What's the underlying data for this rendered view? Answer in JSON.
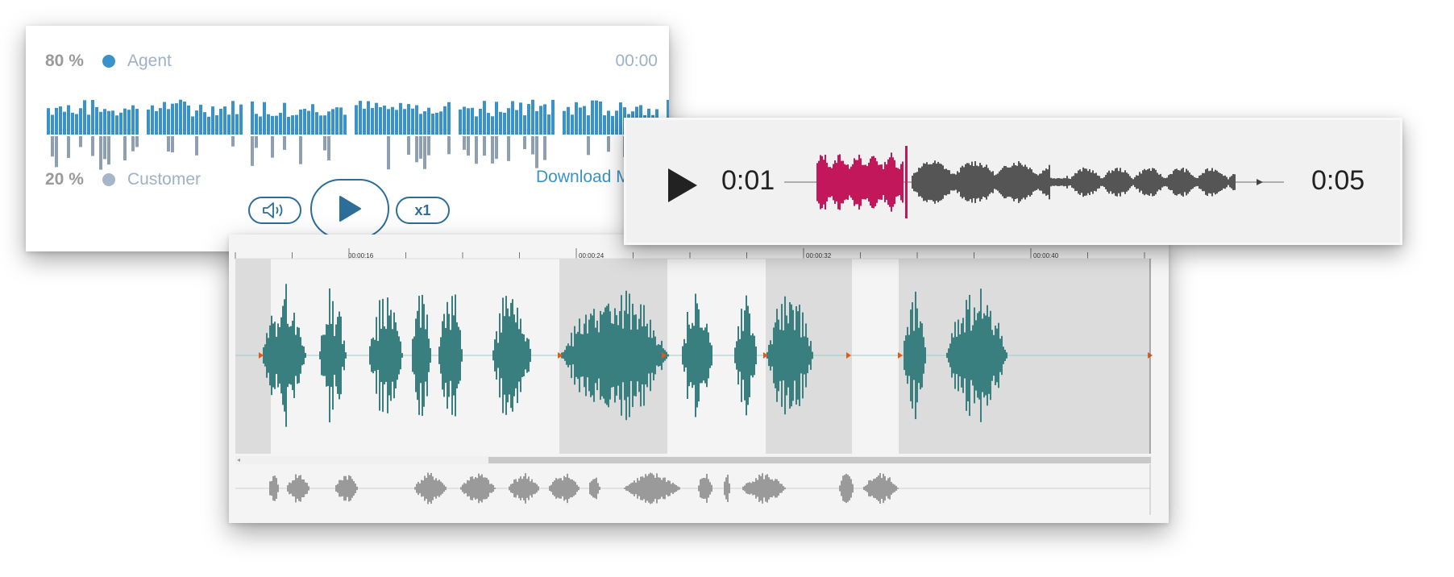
{
  "agent_player": {
    "agent_percent": "80 %",
    "agent_label": "Agent",
    "customer_percent": "20 %",
    "customer_label": "Customer",
    "current_time": "00:00",
    "download_label": "Download M",
    "speed_label": "x1",
    "colors": {
      "agent": "#3a93c8",
      "customer": "#8d9fb0",
      "button": "#2c6e98"
    },
    "icons": {
      "play": "play-icon",
      "volume": "volume-icon"
    }
  },
  "compact_player": {
    "elapsed": "0:01",
    "duration": "0:05",
    "colors": {
      "played": "#c2185b",
      "unplayed": "#555555"
    },
    "icons": {
      "play": "play-icon"
    }
  },
  "timeline_editor": {
    "ticks": [
      "00:00:16",
      "00:00:24",
      "00:00:32",
      "00:00:40"
    ],
    "colors": {
      "waveform": "#3a7f7f",
      "overview": "#9a9a9a",
      "region": "#dcdcdc",
      "marker": "#e05a1a"
    }
  }
}
